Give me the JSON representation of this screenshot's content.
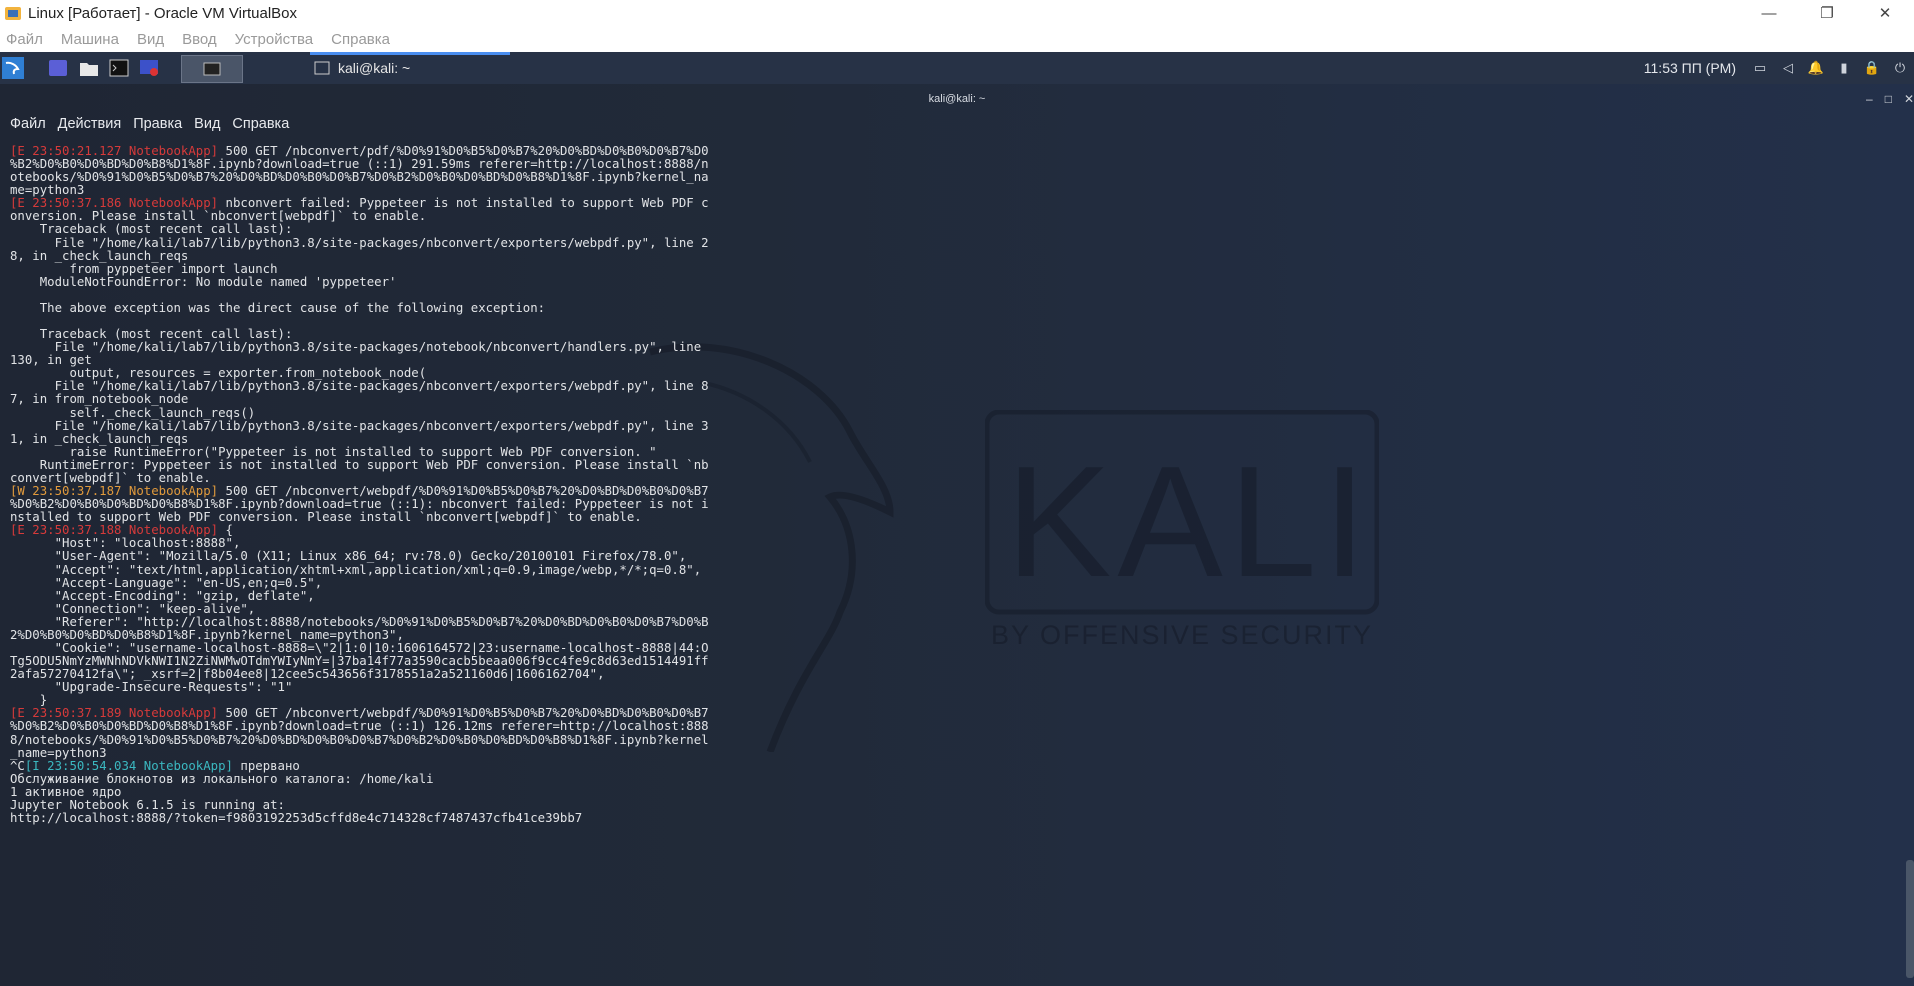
{
  "window": {
    "title": "Linux [Работает] - Oracle VM VirtualBox",
    "controls": {
      "minimize": "—",
      "restore": "❐",
      "close": "✕"
    }
  },
  "vbox_menu": [
    "Файл",
    "Машина",
    "Вид",
    "Ввод",
    "Устройства",
    "Справка"
  ],
  "panel": {
    "task_label": "kali@kali: ~",
    "clock": "11:53 ПП (PM)"
  },
  "terminal": {
    "title": "kali@kali: ~",
    "controls": {
      "minimize": "–",
      "maximize": "□",
      "close": "✕"
    },
    "menu": [
      "Файл",
      "Действия",
      "Правка",
      "Вид",
      "Справка"
    ],
    "lines": [
      [
        {
          "c": "red",
          "t": "[E 23:50:21.127 NotebookApp]"
        },
        {
          "c": "",
          "t": " 500 GET /nbconvert/pdf/%D0%91%D0%B5%D0%B7%20%D0%BD%D0%B0%D0%B7%D0"
        }
      ],
      [
        {
          "c": "",
          "t": "%B2%D0%B0%D0%BD%D0%B8%D1%8F.ipynb?download=true (::1) 291.59ms referer=http://localhost:8888/n"
        }
      ],
      [
        {
          "c": "",
          "t": "otebooks/%D0%91%D0%B5%D0%B7%20%D0%BD%D0%B0%D0%B7%D0%B2%D0%B0%D0%BD%D0%B8%D1%8F.ipynb?kernel_na"
        }
      ],
      [
        {
          "c": "",
          "t": "me=python3"
        }
      ],
      [
        {
          "c": "red",
          "t": "[E 23:50:37.186 NotebookApp]"
        },
        {
          "c": "",
          "t": " nbconvert failed: Pyppeteer is not installed to support Web PDF c"
        }
      ],
      [
        {
          "c": "",
          "t": "onversion. Please install `nbconvert[webpdf]` to enable."
        }
      ],
      [
        {
          "c": "",
          "t": "    Traceback (most recent call last):"
        }
      ],
      [
        {
          "c": "",
          "t": "      File \"/home/kali/lab7/lib/python3.8/site-packages/nbconvert/exporters/webpdf.py\", line 2"
        }
      ],
      [
        {
          "c": "",
          "t": "8, in _check_launch_reqs"
        }
      ],
      [
        {
          "c": "",
          "t": "        from pyppeteer import launch"
        }
      ],
      [
        {
          "c": "",
          "t": "    ModuleNotFoundError: No module named 'pyppeteer'"
        }
      ],
      [
        {
          "c": "",
          "t": ""
        }
      ],
      [
        {
          "c": "",
          "t": "    The above exception was the direct cause of the following exception:"
        }
      ],
      [
        {
          "c": "",
          "t": ""
        }
      ],
      [
        {
          "c": "",
          "t": "    Traceback (most recent call last):"
        }
      ],
      [
        {
          "c": "",
          "t": "      File \"/home/kali/lab7/lib/python3.8/site-packages/notebook/nbconvert/handlers.py\", line"
        }
      ],
      [
        {
          "c": "",
          "t": "130, in get"
        }
      ],
      [
        {
          "c": "",
          "t": "        output, resources = exporter.from_notebook_node("
        }
      ],
      [
        {
          "c": "",
          "t": "      File \"/home/kali/lab7/lib/python3.8/site-packages/nbconvert/exporters/webpdf.py\", line 8"
        }
      ],
      [
        {
          "c": "",
          "t": "7, in from_notebook_node"
        }
      ],
      [
        {
          "c": "",
          "t": "        self._check_launch_reqs()"
        }
      ],
      [
        {
          "c": "",
          "t": "      File \"/home/kali/lab7/lib/python3.8/site-packages/nbconvert/exporters/webpdf.py\", line 3"
        }
      ],
      [
        {
          "c": "",
          "t": "1, in _check_launch_reqs"
        }
      ],
      [
        {
          "c": "",
          "t": "        raise RuntimeError(\"Pyppeteer is not installed to support Web PDF conversion. \""
        }
      ],
      [
        {
          "c": "",
          "t": "    RuntimeError: Pyppeteer is not installed to support Web PDF conversion. Please install `nb"
        }
      ],
      [
        {
          "c": "",
          "t": "convert[webpdf]` to enable."
        }
      ],
      [
        {
          "c": "ora",
          "t": "[W 23:50:37.187 NotebookApp]"
        },
        {
          "c": "",
          "t": " 500 GET /nbconvert/webpdf/%D0%91%D0%B5%D0%B7%20%D0%BD%D0%B0%D0%B7"
        }
      ],
      [
        {
          "c": "",
          "t": "%D0%B2%D0%B0%D0%BD%D0%B8%D1%8F.ipynb?download=true (::1): nbconvert failed: Pyppeteer is not i"
        }
      ],
      [
        {
          "c": "",
          "t": "nstalled to support Web PDF conversion. Please install `nbconvert[webpdf]` to enable."
        }
      ],
      [
        {
          "c": "red",
          "t": "[E 23:50:37.188 NotebookApp]"
        },
        {
          "c": "",
          "t": " {"
        }
      ],
      [
        {
          "c": "",
          "t": "      \"Host\": \"localhost:8888\","
        }
      ],
      [
        {
          "c": "",
          "t": "      \"User-Agent\": \"Mozilla/5.0 (X11; Linux x86_64; rv:78.0) Gecko/20100101 Firefox/78.0\","
        }
      ],
      [
        {
          "c": "",
          "t": "      \"Accept\": \"text/html,application/xhtml+xml,application/xml;q=0.9,image/webp,*/*;q=0.8\","
        }
      ],
      [
        {
          "c": "",
          "t": "      \"Accept-Language\": \"en-US,en;q=0.5\","
        }
      ],
      [
        {
          "c": "",
          "t": "      \"Accept-Encoding\": \"gzip, deflate\","
        }
      ],
      [
        {
          "c": "",
          "t": "      \"Connection\": \"keep-alive\","
        }
      ],
      [
        {
          "c": "",
          "t": "      \"Referer\": \"http://localhost:8888/notebooks/%D0%91%D0%B5%D0%B7%20%D0%BD%D0%B0%D0%B7%D0%B"
        }
      ],
      [
        {
          "c": "",
          "t": "2%D0%B0%D0%BD%D0%B8%D1%8F.ipynb?kernel_name=python3\","
        }
      ],
      [
        {
          "c": "",
          "t": "      \"Cookie\": \"username-localhost-8888=\\\"2|1:0|10:1606164572|23:username-localhost-8888|44:O"
        }
      ],
      [
        {
          "c": "",
          "t": "Tg5ODU5NmYzMWNhNDVkNWI1N2ZiNWMwOTdmYWIyNmY=|37ba14f77a3590cacb5beaa006f9cc4fe9c8d63ed1514491ff"
        }
      ],
      [
        {
          "c": "",
          "t": "2afa57270412fa\\\"; _xsrf=2|f8b04ee8|12cee5c543656f3178551a2a521160d6|1606162704\","
        }
      ],
      [
        {
          "c": "",
          "t": "      \"Upgrade-Insecure-Requests\": \"1\""
        }
      ],
      [
        {
          "c": "",
          "t": "    }"
        }
      ],
      [
        {
          "c": "red",
          "t": "[E 23:50:37.189 NotebookApp]"
        },
        {
          "c": "",
          "t": " 500 GET /nbconvert/webpdf/%D0%91%D0%B5%D0%B7%20%D0%BD%D0%B0%D0%B7"
        }
      ],
      [
        {
          "c": "",
          "t": "%D0%B2%D0%B0%D0%BD%D0%B8%D1%8F.ipynb?download=true (::1) 126.12ms referer=http://localhost:888"
        }
      ],
      [
        {
          "c": "",
          "t": "8/notebooks/%D0%91%D0%B5%D0%B7%20%D0%BD%D0%B0%D0%B7%D0%B2%D0%B0%D0%BD%D0%B8%D1%8F.ipynb?kernel"
        }
      ],
      [
        {
          "c": "",
          "t": "_name=python3"
        }
      ],
      [
        {
          "c": "",
          "t": "^C"
        },
        {
          "c": "cyn",
          "t": "[I 23:50:54.034 NotebookApp]"
        },
        {
          "c": "",
          "t": " прервано"
        }
      ],
      [
        {
          "c": "",
          "t": "Обслуживание блокнотов из локального каталога: /home/kali"
        }
      ],
      [
        {
          "c": "",
          "t": "1 активное ядро"
        }
      ],
      [
        {
          "c": "",
          "t": "Jupyter Notebook 6.1.5 is running at:"
        }
      ],
      [
        {
          "c": "",
          "t": "http://localhost:8888/?token=f9803192253d5cffd8e4c714328cf7487437cfb41ce39bb7"
        }
      ]
    ]
  },
  "wallpaper": {
    "logo_text": "KALI",
    "logo_subtext": "BY OFFENSIVE SECURITY"
  },
  "colors": {
    "error": "#d63a3a",
    "warning": "#e19a3c",
    "info": "#3bb8c0",
    "panel": "#273246"
  }
}
